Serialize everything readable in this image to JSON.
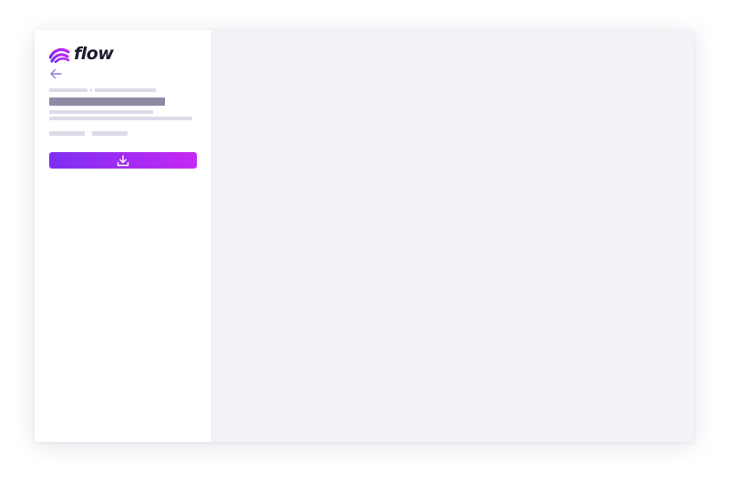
{
  "app": {
    "logo_text": "flow",
    "brand_gradient": [
      "#7d2ff2",
      "#c528f3"
    ],
    "panel_background": "#f3f2f8"
  },
  "sidebar": {
    "back_icon": "arrow-left-icon",
    "download_icon": "download-icon"
  }
}
